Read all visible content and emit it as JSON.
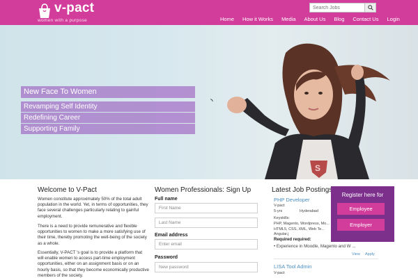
{
  "header": {
    "logo_text": "v-pact",
    "logo_tagline": "women with a purpose",
    "search_placeholder": "Search Jobs",
    "nav": [
      "Home",
      "How it Works",
      "Media",
      "About Us",
      "Blog",
      "Contact Us",
      "Login"
    ],
    "brand_color": "#d23c9b"
  },
  "hero": {
    "headline": "New Face To Women",
    "points": [
      "Revamping Self Identity",
      "Redefining Career",
      "Supporting Family"
    ]
  },
  "welcome": {
    "title": "Welcome to V-Pact",
    "p1": "Women constitute approximately 50% of the total adult population in the world. Yet, in terms of opportunities, they face several challenges particularly relating to gainful employment.",
    "p2": "There is a need to provide remunerative and flexible opportunities to women to make a more satisfying use of their time, thereby promoting the well-being of the society as a whole.",
    "p3": "Essentially, V-PACT 's goal is to provide a platform that will enable women to access part-time employment opportunities, either on an assignment basis or on an hourly basis, so that they become economically productive members of the society."
  },
  "signup": {
    "title": "Women Professionals: Sign Up",
    "full_name_label": "Full name",
    "first_name_placeholder": "First Name",
    "last_name_placeholder": "Last Name",
    "email_label": "Email address",
    "email_placeholder": "Enter email",
    "password_label": "Password",
    "password_placeholder": "New password"
  },
  "jobs": {
    "title": "Latest Job Postings",
    "items": [
      {
        "title": "PHP Developer",
        "company": "V-pact",
        "experience": "5-yrs",
        "location": "Hyderabad",
        "keyskills_label": "Keyskills:",
        "keyskills": "PHP, Magento, Wordpress, Mo... HTML5, CSS, XML, Web Te... Angular.j",
        "required_label": "Required required:",
        "required": "• Experience in Moodle, Magento and W ...",
        "view": "View",
        "apply": "Apply"
      },
      {
        "title": "LISA Tool Admin",
        "company": "V-pact"
      }
    ]
  },
  "register": {
    "title": "Register here for",
    "employee": "Employee",
    "employer": "Employer",
    "panel_color": "#7c2f8b"
  }
}
